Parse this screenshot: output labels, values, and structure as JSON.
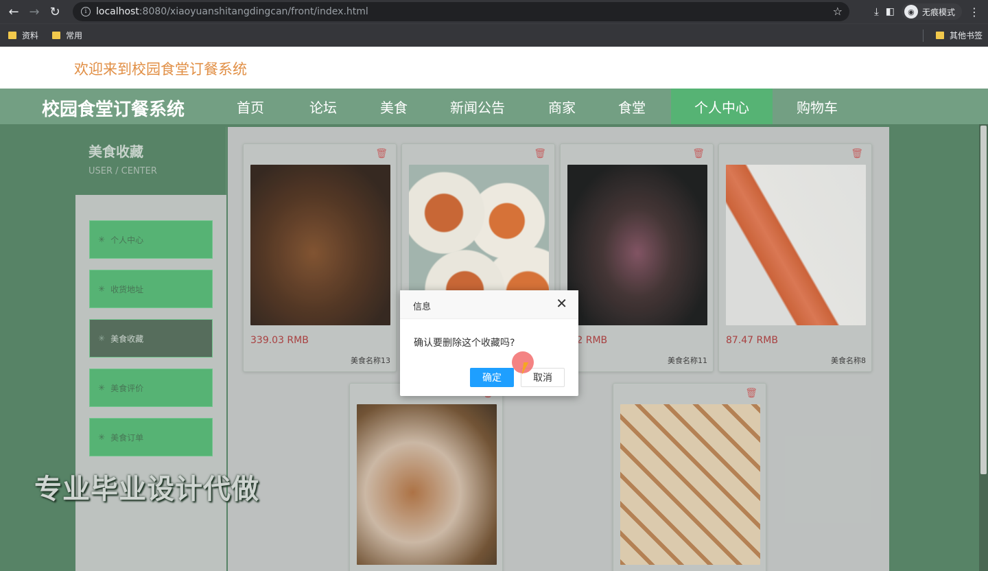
{
  "browser": {
    "url_host": "localhost",
    "url_path": ":8080/xiaoyuanshitangdingcan/front/index.html",
    "incognito_label": "无痕模式",
    "bookmarks": [
      "资料",
      "常用"
    ],
    "other_bookmarks": "其他书签"
  },
  "header": {
    "welcome": "欢迎来到校园食堂订餐系统",
    "brand": "校园食堂订餐系统"
  },
  "nav": {
    "items": [
      "首页",
      "论坛",
      "美食",
      "新闻公告",
      "商家",
      "食堂",
      "个人中心",
      "购物车"
    ],
    "active": "个人中心"
  },
  "sidebar": {
    "title": "美食收藏",
    "subtitle": "USER / CENTER",
    "items": [
      "个人中心",
      "收货地址",
      "美食收藏",
      "美食评价",
      "美食订单"
    ],
    "active": "美食收藏"
  },
  "cards": [
    {
      "price": "339.03 RMB",
      "name": "美食名称13",
      "image": "grilled-steak"
    },
    {
      "price": "",
      "name": "",
      "image": "sushi"
    },
    {
      "price": ".82 RMB",
      "name": "美食名称11",
      "image": "bbq-grill"
    },
    {
      "price": "87.47 RMB",
      "name": "美食名称8",
      "image": "sushi-roll"
    },
    {
      "price": "",
      "name": "",
      "image": "seafood-plate"
    },
    {
      "price": "",
      "name": "",
      "image": "bento-box"
    }
  ],
  "dialog": {
    "title": "信息",
    "message": "确认要删除这个收藏吗?",
    "ok": "确定",
    "cancel": "取消"
  },
  "watermark": "专业毕业设计代做",
  "colors": {
    "accent_green": "#4caf6c",
    "navbar": "#6b9a7c",
    "welcome_text": "#e0883a",
    "price_text": "#a33535",
    "ok_button": "#1e9fff"
  }
}
